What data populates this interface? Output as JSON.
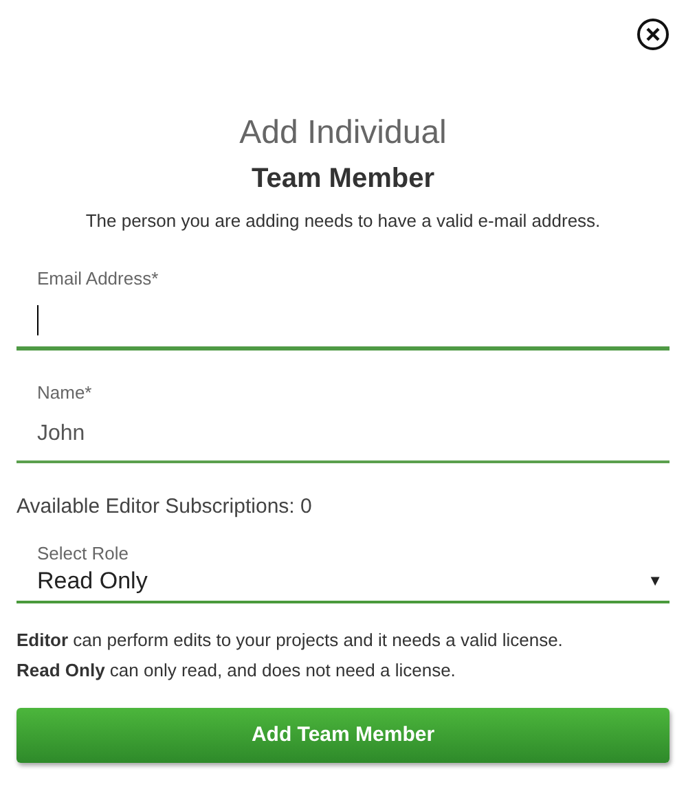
{
  "title": "Add Individual",
  "subtitle": "Team Member",
  "note": "The person you are adding needs to have a valid e-mail address.",
  "fields": [
    {
      "label": "Email Address*",
      "focused": true
    },
    {
      "label": "Name*",
      "value": "John",
      "focused": false
    }
  ],
  "subscriptions": "Available Editor Subscriptions: 0",
  "role_select": {
    "label": "Select Role",
    "value": "Read Only",
    "arrow": "▼"
  },
  "role_notes": [
    "**Editor** can perform edits to your projects and it needs a valid license.",
    "**Read Only** can only read, and does not need a license."
  ],
  "submit_button": "Add Team Member"
}
